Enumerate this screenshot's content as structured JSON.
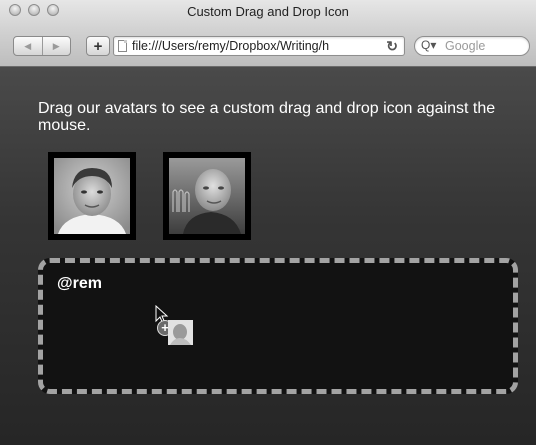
{
  "window": {
    "title": "Custom Drag and Drop Icon"
  },
  "toolbar": {
    "back_label": "◀",
    "forward_label": "▶",
    "add_label": "+",
    "url": "file:///Users/remy/Dropbox/Writing/h",
    "reload_label": "↻",
    "search_placeholder": "Google",
    "search_icon_label": "Q▾"
  },
  "page": {
    "intro": "Drag our avatars to see a custom drag and drop icon against the mouse.",
    "avatars": [
      {
        "icon": "avatar-remy"
      },
      {
        "icon": "avatar-bruce"
      }
    ],
    "dropzone": {
      "name": "@rem"
    },
    "drag_badge": "+"
  },
  "colors": {
    "page_bg_top": "#4a4a4a",
    "page_bg_bottom": "#262626",
    "dropzone_bg": "#121212",
    "dropzone_border": "#a3a3a3",
    "text": "#ffffff"
  }
}
